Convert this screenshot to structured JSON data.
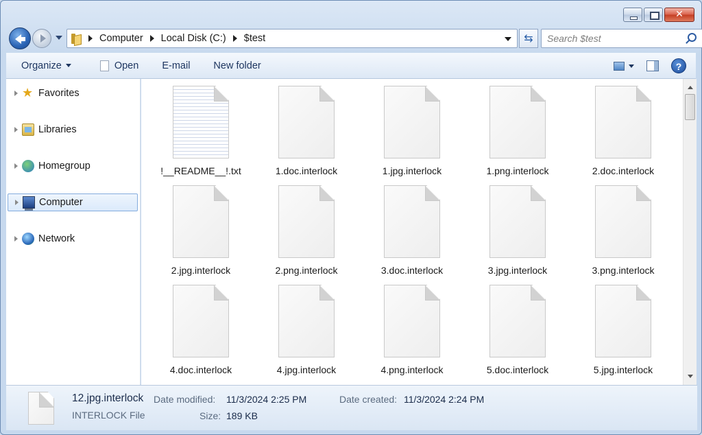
{
  "address": {
    "crumbs": [
      "Computer",
      "Local Disk (C:)",
      "$test"
    ]
  },
  "search": {
    "placeholder": "Search $test"
  },
  "toolbar": {
    "organize": "Organize",
    "open": "Open",
    "email": "E-mail",
    "new_folder": "New folder"
  },
  "nav": {
    "favorites": "Favorites",
    "libraries": "Libraries",
    "homegroup": "Homegroup",
    "computer": "Computer",
    "network": "Network",
    "selected": "Computer"
  },
  "files": [
    "!__README__!.txt",
    "1.doc.interlock",
    "1.jpg.interlock",
    "1.png.interlock",
    "2.doc.interlock",
    "2.jpg.interlock",
    "2.png.interlock",
    "3.doc.interlock",
    "3.jpg.interlock",
    "3.png.interlock",
    "4.doc.interlock",
    "4.jpg.interlock",
    "4.png.interlock",
    "5.doc.interlock",
    "5.jpg.interlock"
  ],
  "details": {
    "name": "12.jpg.interlock",
    "type": "INTERLOCK File",
    "modified_label": "Date modified:",
    "modified_value": "11/3/2024 2:25 PM",
    "size_label": "Size:",
    "size_value": "189 KB",
    "created_label": "Date created:",
    "created_value": "11/3/2024 2:24 PM"
  }
}
